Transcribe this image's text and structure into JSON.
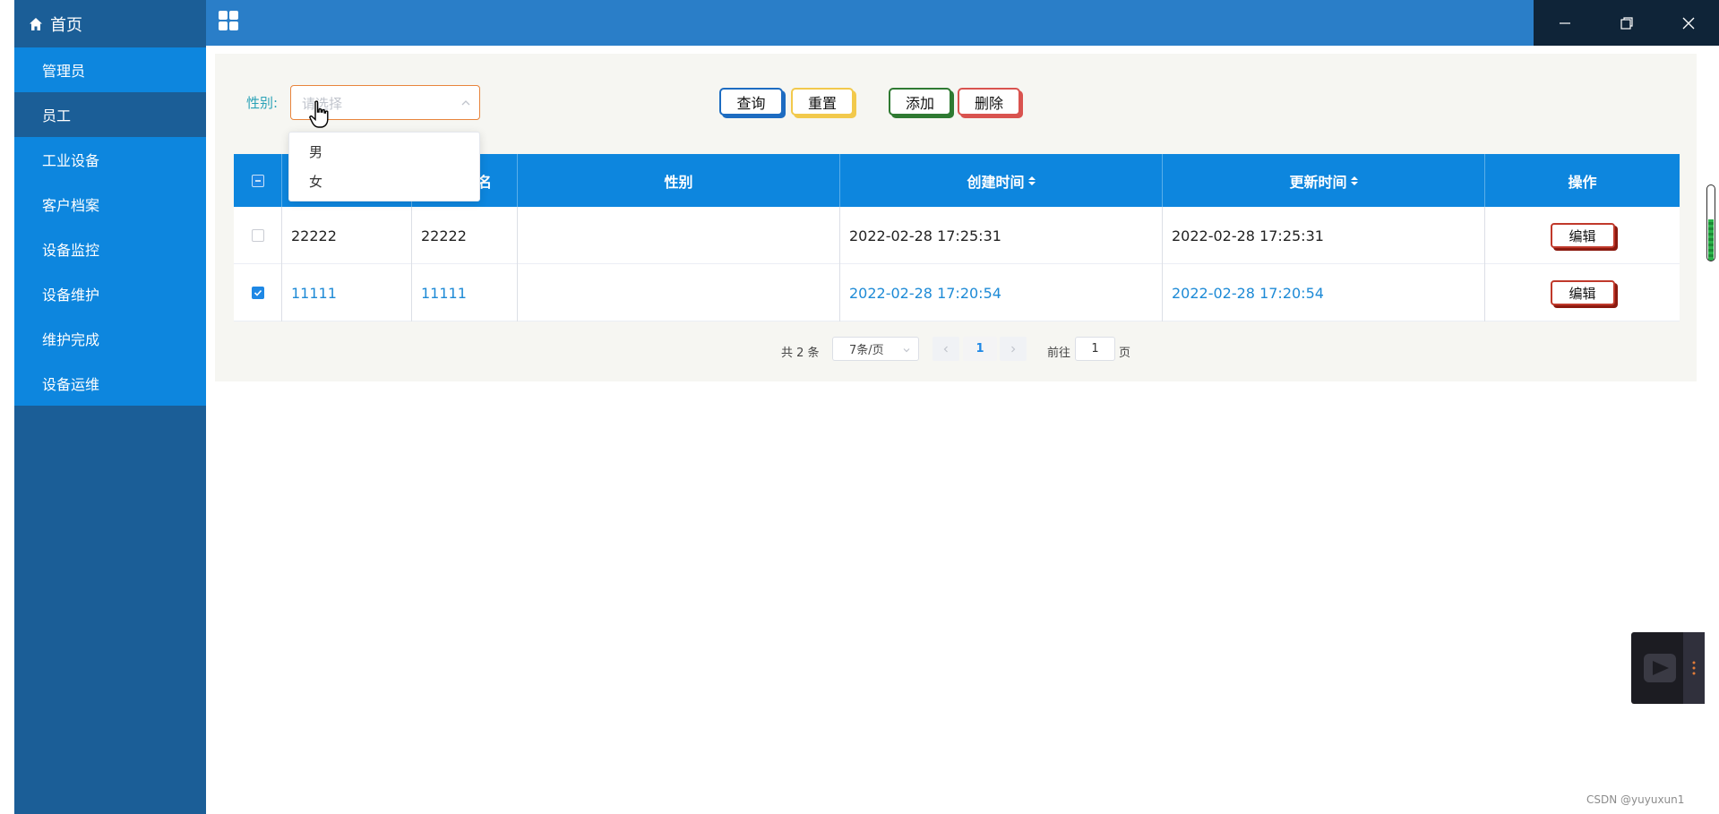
{
  "sidebar": {
    "home_label": "首页",
    "items": [
      {
        "label": "管理员"
      },
      {
        "label": "员工"
      },
      {
        "label": "工业设备"
      },
      {
        "label": "客户档案"
      },
      {
        "label": "设备监控"
      },
      {
        "label": "设备维护"
      },
      {
        "label": "维护完成"
      },
      {
        "label": "设备运维"
      }
    ],
    "active_item": "员工"
  },
  "filter": {
    "gender_label": "性别:",
    "gender_placeholder": "请选择",
    "options": [
      "男",
      "女"
    ]
  },
  "buttons": {
    "query": "查询",
    "reset": "重置",
    "add": "添加",
    "delete": "删除"
  },
  "table": {
    "columns": [
      "",
      "",
      "名",
      "性别",
      "创建时间",
      "更新时间",
      "操作"
    ],
    "rows": [
      {
        "selected": false,
        "c1": "22222",
        "c2": "22222",
        "gender": "",
        "created": "2022-02-28 17:25:31",
        "updated": "2022-02-28 17:25:31",
        "action": "编辑"
      },
      {
        "selected": true,
        "c1": "11111",
        "c2": "11111",
        "gender": "",
        "created": "2022-02-28 17:20:54",
        "updated": "2022-02-28 17:20:54",
        "action": "编辑"
      }
    ]
  },
  "pagination": {
    "total_text": "共 2 条",
    "page_size": "7条/页",
    "current_page": "1",
    "goto_label": "前往",
    "goto_value": "1",
    "page_suffix": "页"
  },
  "colors": {
    "sidebar_bg": "#1b5e97",
    "sidebar_item_bg": "#0d86de",
    "topbar_bg": "#2a7ec8",
    "table_header_bg": "#0d86de",
    "link_blue": "#1d8ad6"
  },
  "watermark": "CSDN @yuyuxun1"
}
